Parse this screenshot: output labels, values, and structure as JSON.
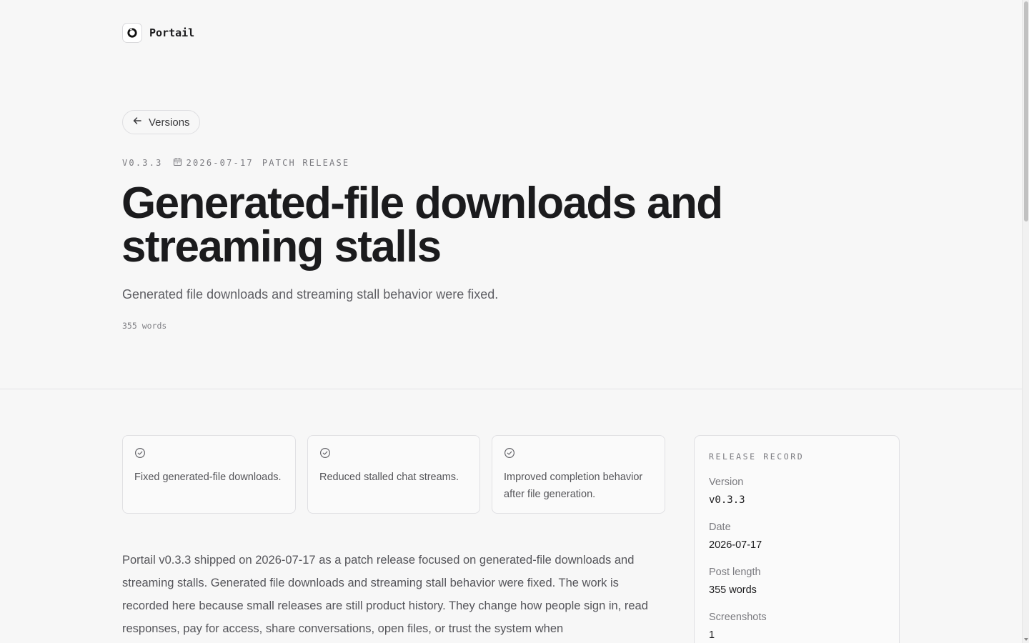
{
  "brand": {
    "name": "Portail"
  },
  "nav": {
    "back_label": "Versions"
  },
  "release": {
    "version_tag": "v0.3.3",
    "date": "2026-07-17",
    "kind": "Patch release",
    "title": "Generated-file downloads and streaming stalls",
    "subtitle": "Generated file downloads and streaming stall behavior were fixed.",
    "word_count": "355 words"
  },
  "highlights": [
    {
      "text": "Fixed generated-file downloads."
    },
    {
      "text": "Reduced stalled chat streams."
    },
    {
      "text": "Improved completion behavior after file generation."
    }
  ],
  "body": {
    "paragraph": "Portail v0.3.3 shipped on 2026-07-17 as a patch release focused on generated-file downloads and streaming stalls. Generated file downloads and streaming stall behavior were fixed. The work is recorded here because small releases are still product history. They change how people sign in, read responses, pay for access, share conversations, open files, or trust the system when"
  },
  "record": {
    "title": "Release record",
    "rows": [
      {
        "label": "Version",
        "value": "v0.3.3"
      },
      {
        "label": "Date",
        "value": "2026-07-17"
      },
      {
        "label": "Post length",
        "value": "355 words"
      },
      {
        "label": "Screenshots",
        "value": "1"
      }
    ]
  },
  "icons": {
    "brand": "ring-logo-icon",
    "back": "arrow-left-icon",
    "date": "calendar-icon",
    "highlight": "check-circle-icon"
  },
  "colors": {
    "text": "#1b1b1d",
    "muted": "#5e5e63",
    "background": "#f7f7f7",
    "border": "#e0e0e3"
  }
}
